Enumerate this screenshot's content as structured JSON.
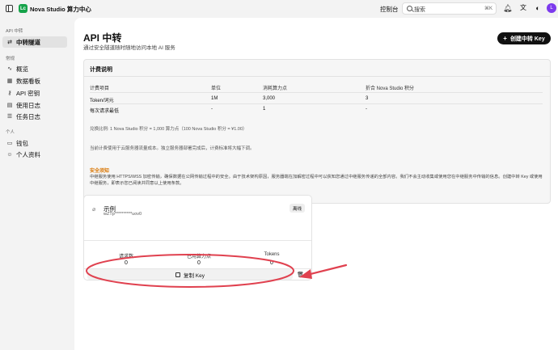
{
  "topbar": {
    "logo_text": "Lc",
    "app_title": "Nova Studio 算力中心",
    "console": "控制台",
    "search_placeholder": "搜索",
    "search_shortcut": "⌘K",
    "avatar_initial": "L"
  },
  "sidebar": {
    "section_api": "API 中转",
    "relay_item": "中转隧道",
    "section_common": "常规",
    "items": [
      "概览",
      "数据看板",
      "API 密钥",
      "使用日志",
      "任务日志"
    ],
    "section_personal": "个人",
    "personal_items": [
      "钱包",
      "个人资料"
    ]
  },
  "page": {
    "title": "API 中转",
    "subtitle": "通过安全隧道随时随地访问本地 AI 服务",
    "create_button": "创建中转 Key"
  },
  "billing": {
    "title": "计费说明",
    "headers": [
      "计费项目",
      "单位",
      "消耗算力点",
      "折合 Nova Studio 积分"
    ],
    "rows": [
      [
        "Token/词元",
        "1M",
        "3,000",
        "3"
      ],
      [
        "每次请求最低",
        "-",
        "1",
        "-"
      ]
    ],
    "exchange_note": "兑换比例: 1 Nova Studio 积分 = 1,000 算力点（100 Nova Studio 积分 = ¥1.00）",
    "cost_note": "当前计费使用于云服务器流量成本。独立服务器部署完成后，计费标准将大幅下调。",
    "security_title": "安全须知",
    "security_text": "中继服务使用 HTTPS/WSS 加密传输，确保数据在公网传输过程中的安全。由于技术架构原因，服务器端在加解密过程中可以获知您通过中继服务传递的全部内容。我们不会主动收集或使用您在中继服务中传输的信息。创建中转 Key 或使用中继服务，即表示您已阅读并同意以上使用条款。"
  },
  "relay": {
    "name": "示例",
    "key_masked": "wZTp**********uov0",
    "status": "离线",
    "stats": [
      {
        "label": "请求数",
        "value": "0"
      },
      {
        "label": "已用算力点",
        "value": "0"
      },
      {
        "label": "Tokens",
        "value": "0"
      }
    ],
    "copy_button": "复制 Key"
  },
  "colors": {
    "accent_green": "#16a34a",
    "annotation_red": "#e0414f",
    "warning_orange": "#d97706"
  }
}
